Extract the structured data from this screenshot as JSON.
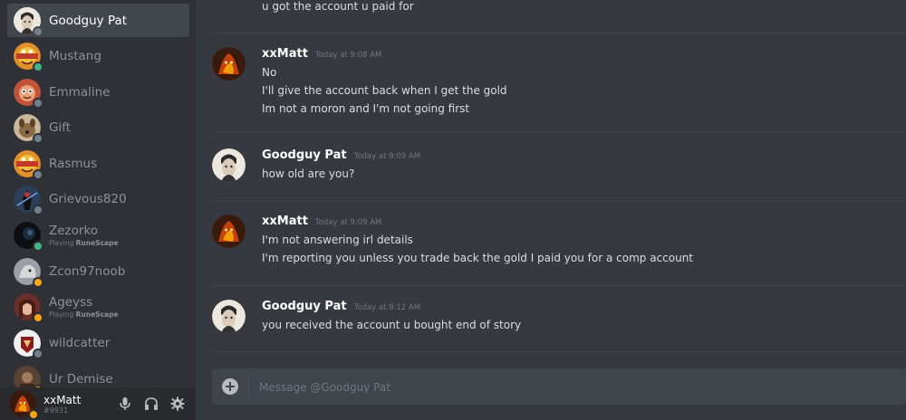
{
  "dm_list": [
    {
      "name": "Goodguy Pat",
      "activity": "",
      "game": "",
      "status": "offline",
      "avatar": "face-sketch"
    },
    {
      "name": "Mustang",
      "activity": "",
      "game": "",
      "status": "online",
      "avatar": "cartoon-badge"
    },
    {
      "name": "Emmaline",
      "activity": "",
      "game": "",
      "status": "offline",
      "avatar": "cartoon-red"
    },
    {
      "name": "Gift",
      "activity": "",
      "game": "",
      "status": "offline",
      "avatar": "dog"
    },
    {
      "name": "Rasmus",
      "activity": "",
      "game": "",
      "status": "offline",
      "avatar": "cartoon-badge"
    },
    {
      "name": "Grievous820",
      "activity": "",
      "game": "",
      "status": "offline",
      "avatar": "figure-dark"
    },
    {
      "name": "Zezorko",
      "activity": "Playing ",
      "game": "RuneScape",
      "status": "online",
      "avatar": "dark-orb"
    },
    {
      "name": "Zcon97noob",
      "activity": "",
      "game": "",
      "status": "idle",
      "avatar": "grey-beast"
    },
    {
      "name": "Ageyss",
      "activity": "Playing ",
      "game": "RuneScape",
      "status": "idle",
      "avatar": "portrait-girl"
    },
    {
      "name": "wildcatter",
      "activity": "",
      "game": "",
      "status": "offline",
      "avatar": "red-emblem"
    },
    {
      "name": "Ur Demise",
      "activity": "",
      "game": "",
      "status": "idle",
      "avatar": "brown-photo"
    }
  ],
  "current_user": {
    "name": "xxMatt",
    "tag": "#9931",
    "status": "idle"
  },
  "user_controls": {
    "mic_icon": "microphone-icon",
    "headphones_icon": "headphones-icon",
    "settings_icon": "gear-icon"
  },
  "messages": [
    {
      "author": "",
      "timestamp": "",
      "lines": [
        "u got the account u paid for"
      ]
    },
    {
      "author": "xxMatt",
      "timestamp": "Today at 9:08 AM",
      "avatar": "fire-demon",
      "lines": [
        "No",
        "I'll give the account back when I get the gold",
        "Im not a moron and I'm not going first"
      ]
    },
    {
      "author": "Goodguy Pat",
      "timestamp": "Today at 9:09 AM",
      "avatar": "face-sketch",
      "lines": [
        "how old are you?"
      ]
    },
    {
      "author": "xxMatt",
      "timestamp": "Today at 9:09 AM",
      "avatar": "fire-demon",
      "lines": [
        "I'm not answering irl details",
        "I'm reporting you unless you trade back the gold I paid you for a comp account"
      ]
    },
    {
      "author": "Goodguy Pat",
      "timestamp": "Today at 9:12 AM",
      "avatar": "face-sketch",
      "lines": [
        "you received the account u bought end of story"
      ]
    }
  ],
  "composer": {
    "placeholder": "Message @Goodguy Pat",
    "value": "",
    "add_icon": "plus-circle-icon"
  },
  "colors": {
    "background": "#36393f",
    "sidebar": "#2f3136",
    "userbar": "#292b2f",
    "online": "#43b581",
    "idle": "#faa61a",
    "offline": "#747f8d"
  }
}
